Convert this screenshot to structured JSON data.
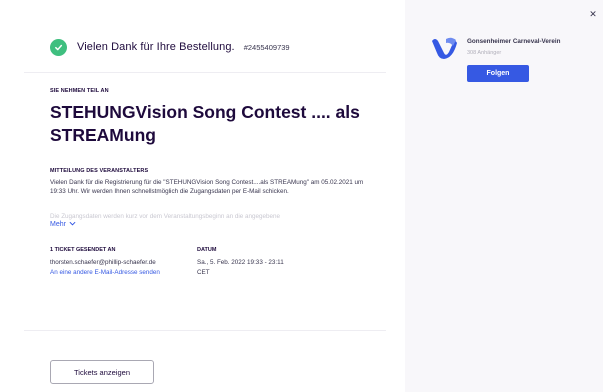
{
  "confirmation": {
    "thanks_text": "Vielen Dank für Ihre Bestellung.",
    "order_number": "#2455409739",
    "check_color": "#3fbf7f"
  },
  "event": {
    "attend_label": "SIE NEHMEN TEIL AN",
    "title": "STEHUNGVision Song Contest .... als STREAMung"
  },
  "organizer_message": {
    "label": "MITTEILUNG DES VERANSTALTERS",
    "text": "Vielen Dank für die Registrierung für die \"STEHUNGVision Song Contest....als STREAMung\" am 05.02.2021 um 19:33 Uhr. Wir werden Ihnen schnellstmöglich die Zugangsdaten per E-Mail schicken.",
    "faded_text": "Die Zugangsdaten werden kurz vor dem Veranstaltungsbeginn an die angegebene",
    "more_label": "Mehr"
  },
  "ticket": {
    "label": "1 TICKET GESENDET AN",
    "email": "thorsten.schaefer@phillip-schaefer.de",
    "resend_link": "An eine andere E-Mail-Adresse senden"
  },
  "date": {
    "label": "DATUM",
    "value": "Sa., 5. Feb. 2022 19:33 - 23:11 CET"
  },
  "actions": {
    "tickets_button": "Tickets anzeigen"
  },
  "sidebar": {
    "close_icon": "close-icon",
    "organizer_name": "Gonsenheimer Carneval-Verein",
    "followers": "308 Anhänger",
    "follow_button": "Folgen",
    "accent_color": "#3659e3"
  }
}
